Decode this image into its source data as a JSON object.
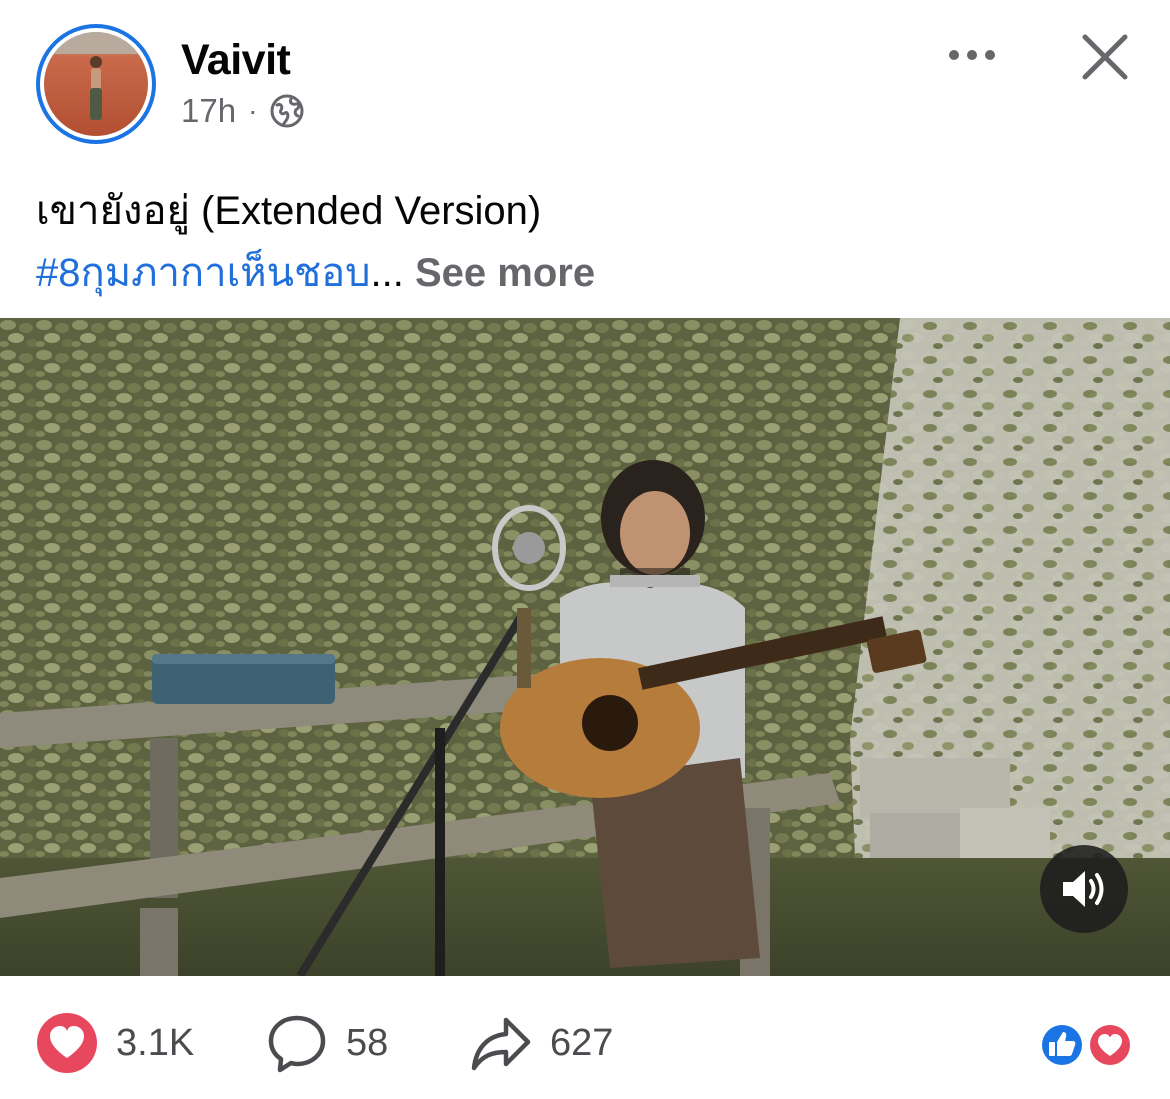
{
  "post": {
    "author": "Vaivit",
    "time": "17h",
    "separator": "·",
    "privacy_icon": "globe-icon",
    "caption_title": "เขายังอยู่ (Extended Version)",
    "hashtag": "#8กุมภากาเห็นชอบ",
    "ellipsis": "...",
    "see_more": "See more"
  },
  "header": {
    "more_icon": "more-horizontal-icon",
    "close_icon": "close-icon"
  },
  "video": {
    "sound_icon": "speaker-icon"
  },
  "stats": {
    "reactions": "3.1K",
    "comments": "58",
    "shares": "627"
  },
  "colors": {
    "accent_blue": "#1b74e4",
    "link_blue": "#216fdb",
    "love_red": "#e8485e",
    "muted_gray": "#65676b"
  }
}
